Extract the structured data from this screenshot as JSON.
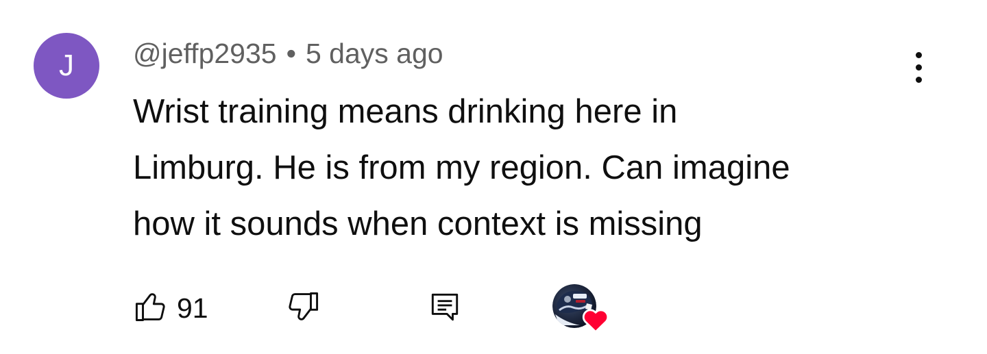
{
  "comment": {
    "avatar_letter": "J",
    "avatar_color": "#7e57c2",
    "author": "@jeffp2935",
    "separator": "•",
    "timestamp": "5 days ago",
    "text_lines": [
      "Wrist training means drinking here in",
      "Limburg. He is from my region. Can imagine",
      "how it sounds when context is missing"
    ],
    "menu_icon": "more-vertical-icon"
  },
  "actions": {
    "like_icon": "thumbs-up-icon",
    "like_count": "91",
    "dislike_icon": "thumbs-down-icon",
    "reply_icon": "reply-comment-icon",
    "creator_heart": {
      "avatar_icon": "creator-avatar-icon",
      "heart_icon": "heart-icon",
      "heart_color": "#ff0033"
    }
  }
}
